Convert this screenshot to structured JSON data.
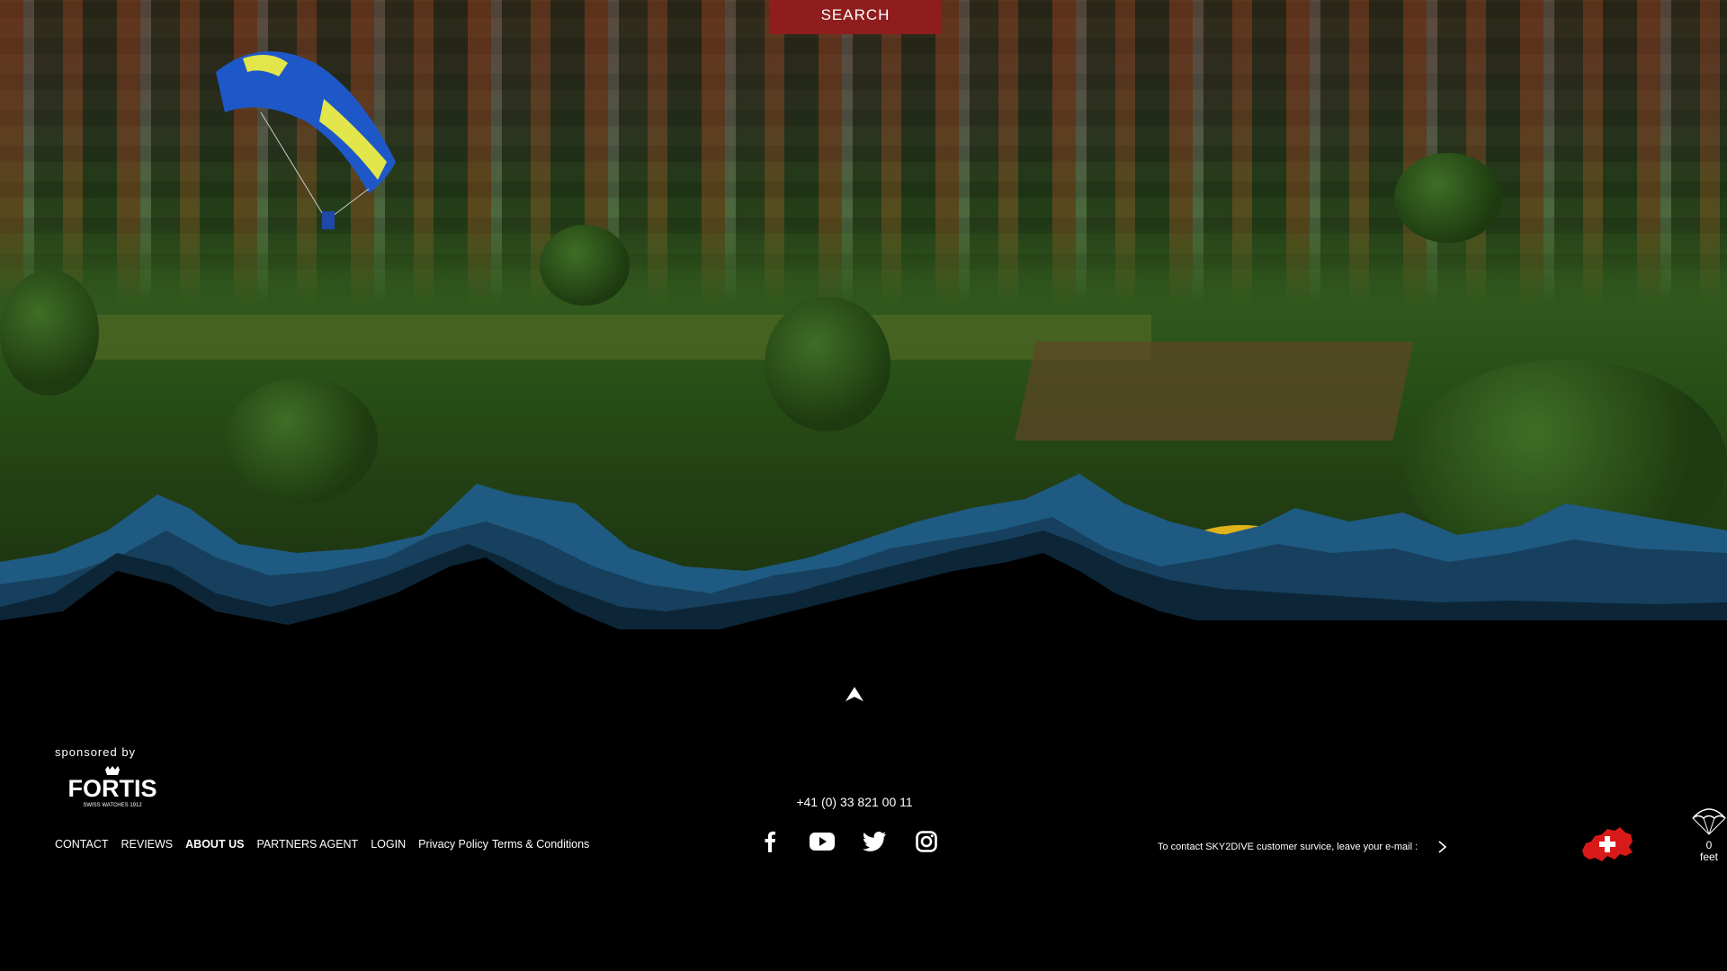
{
  "header": {
    "search_label": "SEARCH"
  },
  "footer": {
    "sponsor_label": "sponsored by",
    "sponsor_logo_text": "FORTIS",
    "sponsor_logo_sub": "SWISS WATCHES 1912",
    "phone": "+41 (0) 33 821 00 11",
    "nav": [
      {
        "label": "CONTACT",
        "active": false
      },
      {
        "label": "REVIEWS",
        "active": false
      },
      {
        "label": "ABOUT US",
        "active": true
      },
      {
        "label": "PARTNERS AGENT",
        "active": false
      },
      {
        "label": "LOGIN",
        "active": false
      },
      {
        "label": "Privacy Policy",
        "active": false
      },
      {
        "label": "Terms & Conditions",
        "active": false
      }
    ],
    "social": [
      "facebook-icon",
      "youtube-icon",
      "twitter-icon",
      "instagram-icon"
    ],
    "contact_text": "To contact SKY2DIVE customer survice, leave your e-mail :",
    "altimeter": {
      "value": "0",
      "unit": "feet"
    }
  },
  "colors": {
    "accent_red": "#8f1d1d",
    "mountain_light": "#1f5a82",
    "mountain_mid": "#16405e",
    "mountain_dark": "#0c2638",
    "background": "#000000"
  }
}
